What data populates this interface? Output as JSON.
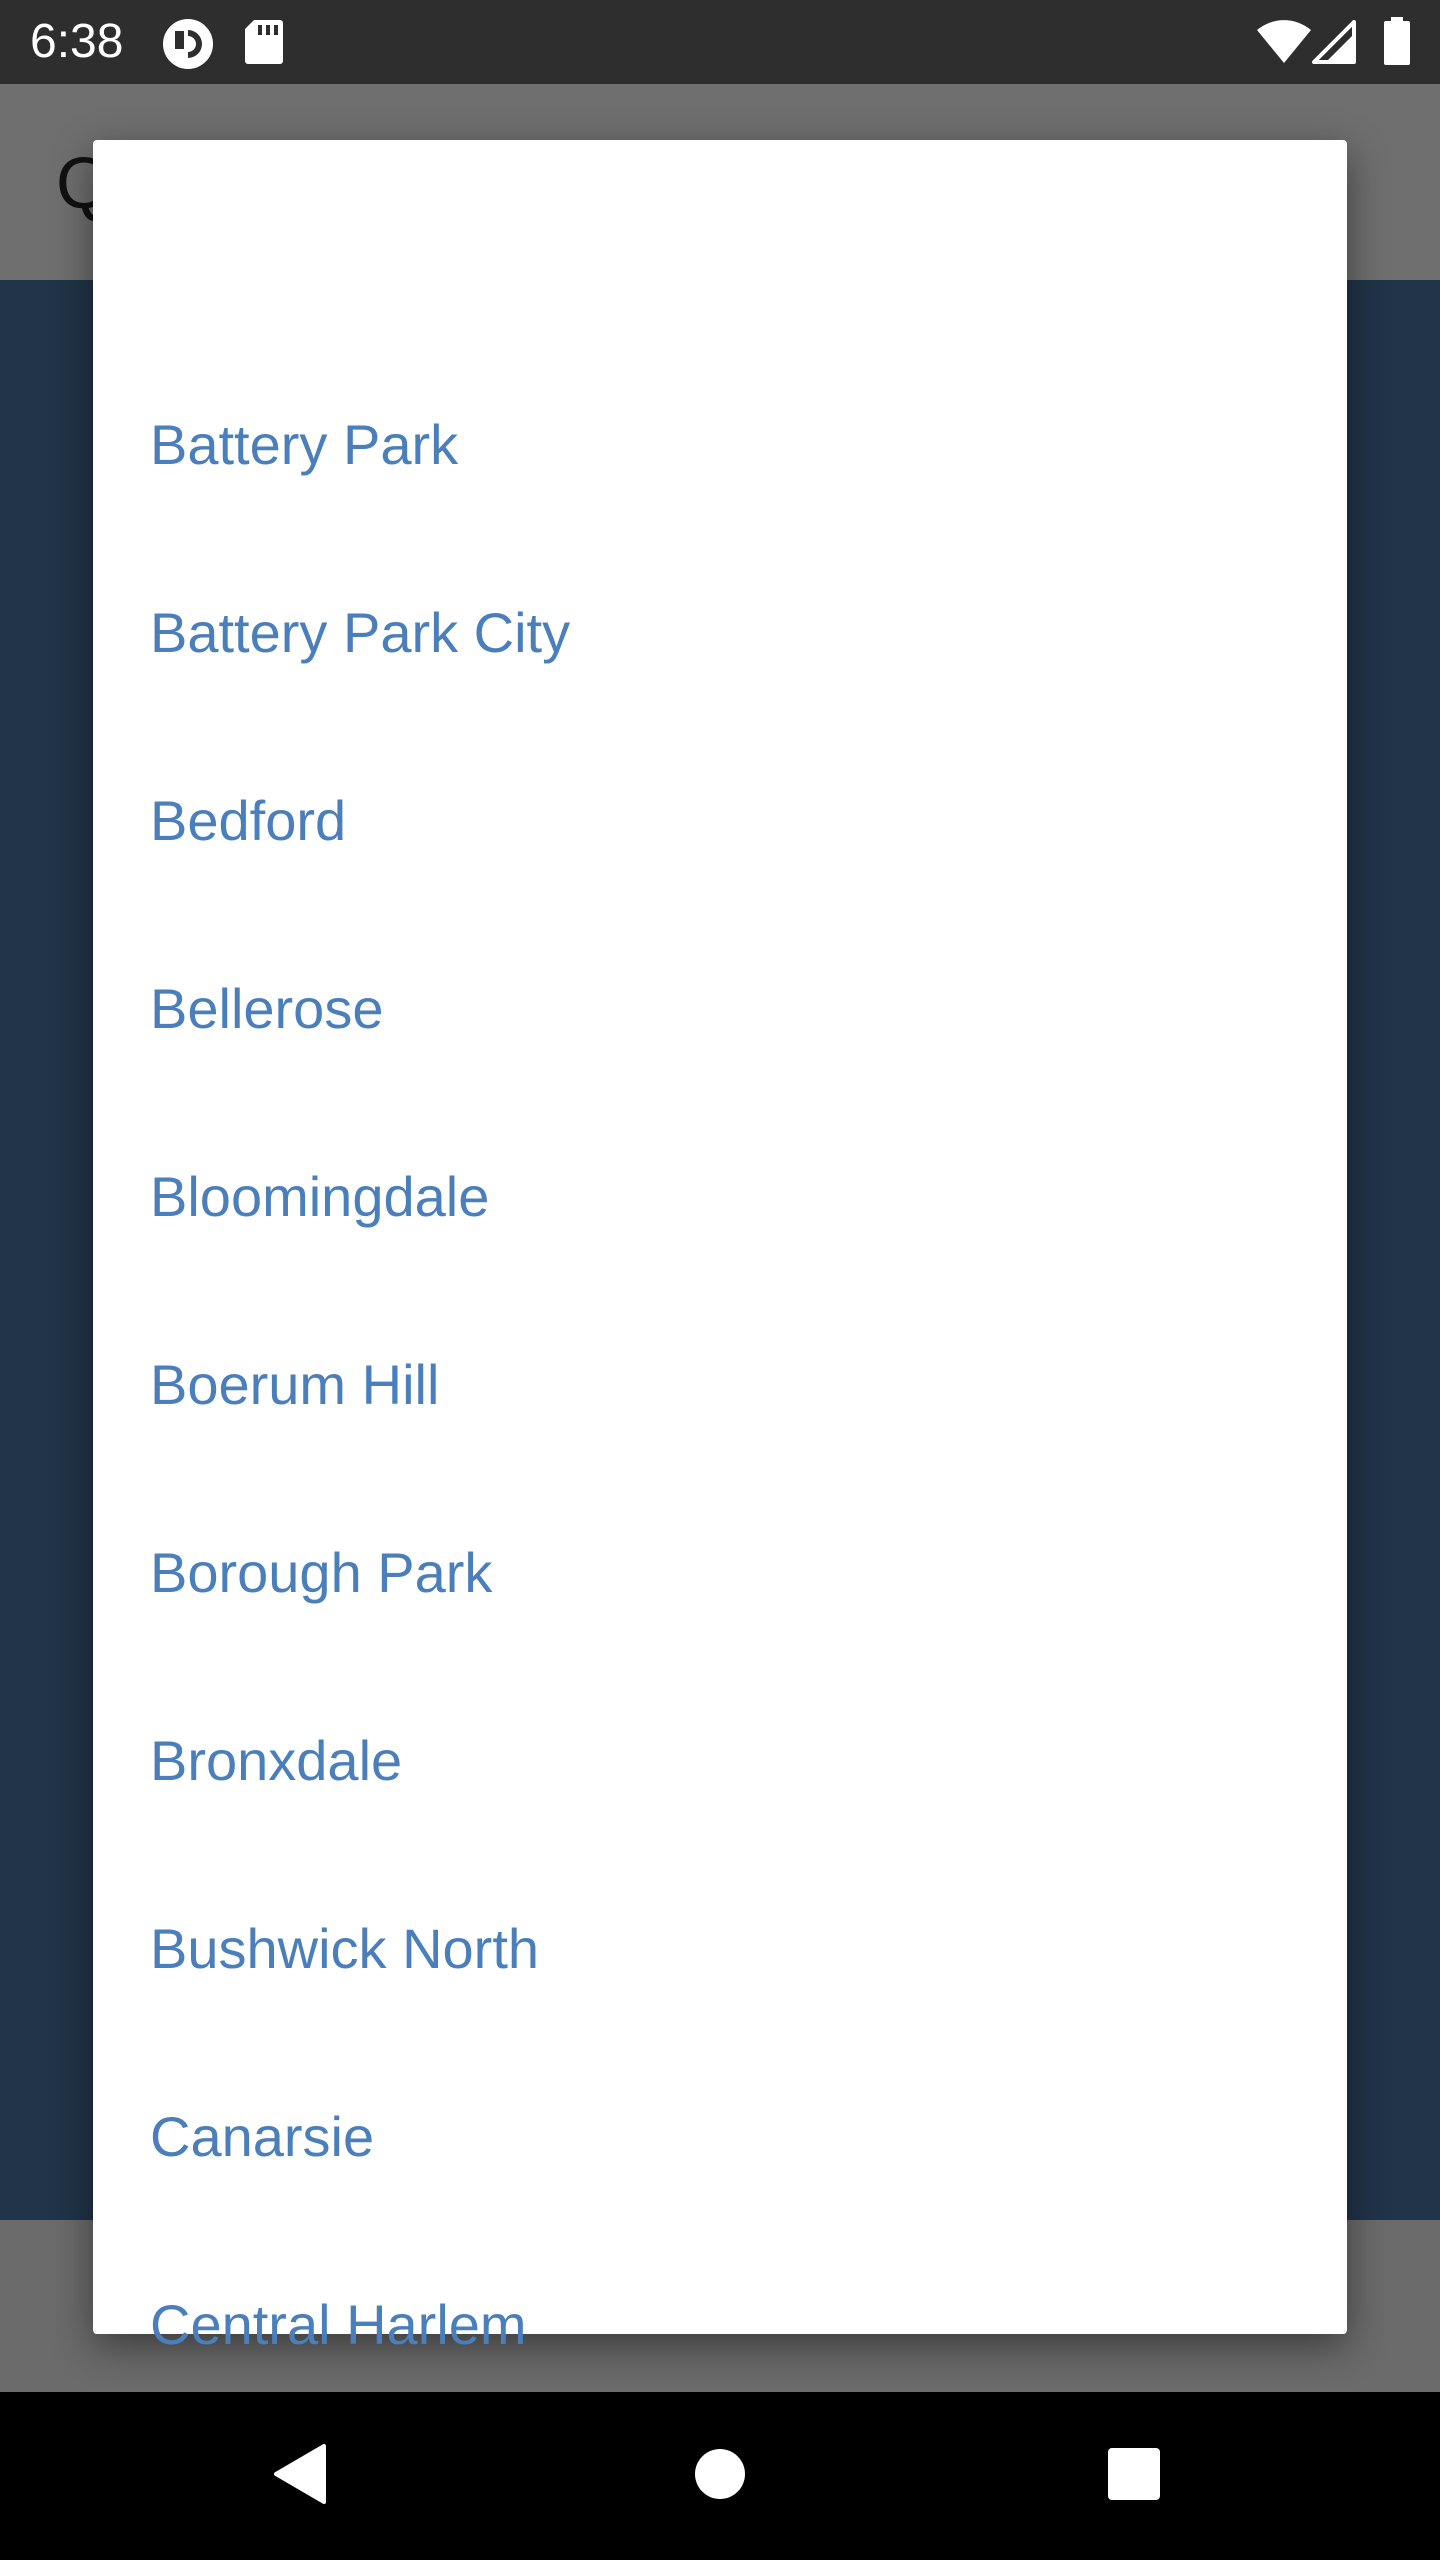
{
  "status_bar": {
    "time": "6:38",
    "icons": [
      "app-notification-icon",
      "sd-card-icon",
      "wifi-icon",
      "cell-signal-icon",
      "battery-icon"
    ]
  },
  "app": {
    "title_partial": "Q"
  },
  "dialog": {
    "options": [
      {
        "label": "Battery Park"
      },
      {
        "label": "Battery Park City"
      },
      {
        "label": "Bedford"
      },
      {
        "label": "Bellerose"
      },
      {
        "label": "Bloomingdale"
      },
      {
        "label": "Boerum Hill"
      },
      {
        "label": "Borough Park"
      },
      {
        "label": "Bronxdale"
      },
      {
        "label": "Bushwick North"
      },
      {
        "label": "Canarsie"
      },
      {
        "label": "Central Harlem"
      }
    ]
  },
  "nav_bar": {
    "buttons": [
      "back-icon",
      "home-icon",
      "recents-icon"
    ]
  },
  "colors": {
    "option_text": "#4a7fbb",
    "status_bar_bg": "#2e2e2e",
    "scrim_content": "#213449",
    "dialog_bg": "#ffffff",
    "nav_bar_bg": "#000000"
  }
}
